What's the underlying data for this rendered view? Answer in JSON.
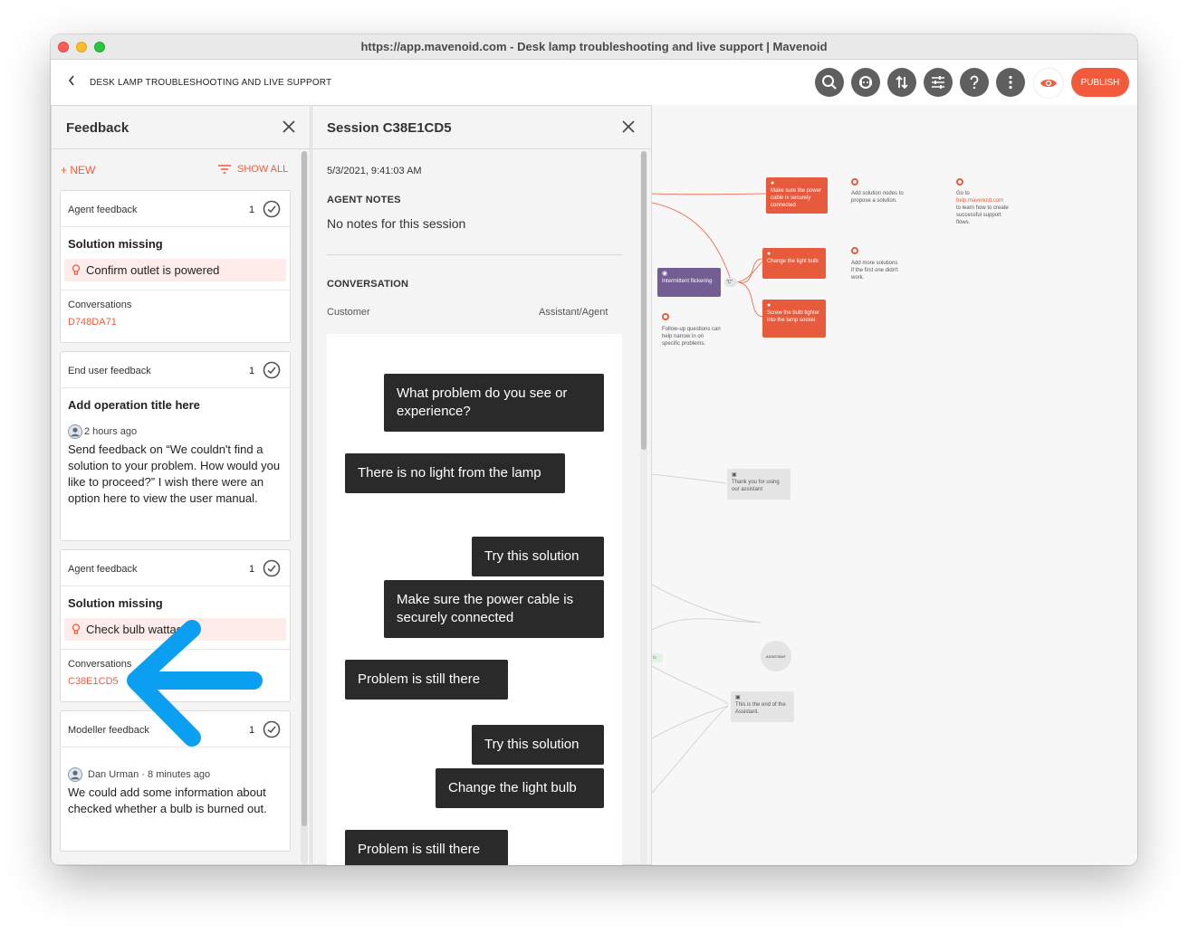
{
  "window": {
    "title": "https://app.mavenoid.com - Desk lamp troubleshooting and live support | Mavenoid"
  },
  "header": {
    "back_icon": "chevron-left-icon",
    "breadcrumb": "DESK LAMP TROUBLESHOOTING AND LIVE SUPPORT",
    "tools": [
      "search-icon",
      "agent-icon",
      "sort-icon",
      "sliders-icon",
      "help-icon",
      "more-icon"
    ],
    "preview_icon": "eye-icon",
    "publish_label": "PUBLISH",
    "accent": "#f15a3a"
  },
  "feedback": {
    "title": "Feedback",
    "new_label": "+ NEW",
    "show_all_label": "SHOW ALL",
    "cards": [
      {
        "type": "Agent feedback",
        "count": "1",
        "title": "Solution missing",
        "solution": "Confirm outlet is powered",
        "conversations_label": "Conversations",
        "conversation_id": "D748DA71"
      },
      {
        "type": "End user feedback",
        "count": "1",
        "title": "Add operation title here",
        "meta": "2 hours ago",
        "body": "Send feedback on “We couldn't find a solution to your problem. How would you like to proceed?” I wish there were an option here to view the user manual."
      },
      {
        "type": "Agent feedback",
        "count": "1",
        "title": "Solution missing",
        "solution": "Check bulb wattage",
        "conversations_label": "Conversations",
        "conversation_id": "C38E1CD5"
      },
      {
        "type": "Modeller feedback",
        "count": "1",
        "meta": "Dan Urman · 8 minutes ago",
        "body": "We could add some information about checked whether a bulb is burned out."
      }
    ]
  },
  "session": {
    "title": "Session C38E1CD5",
    "date": "5/3/2021, 9:41:03 AM",
    "notes_label": "AGENT NOTES",
    "notes": "No notes for this session",
    "conversation_label": "CONVERSATION",
    "customer_label": "Customer",
    "agent_label": "Assistant/Agent",
    "messages": [
      {
        "side": "right",
        "text": "What problem do you see or experience?"
      },
      {
        "side": "left",
        "text": "There is no light from the lamp"
      },
      {
        "side": "right",
        "text": "Try this solution"
      },
      {
        "side": "right",
        "text": "Make sure the power cable is securely connected"
      },
      {
        "side": "left",
        "text": "Problem is still there"
      },
      {
        "side": "right",
        "text": "Try this solution"
      },
      {
        "side": "right",
        "text": "Change the light bulb"
      },
      {
        "side": "left",
        "text": "Problem is still there"
      }
    ]
  },
  "flow": {
    "solution_1": "Make sure the power cable is securely connected",
    "solution_2": "Change the light bulb",
    "solution_3": "Screw the bulb tighter into the lamp socket",
    "question": "Intermittent flickering",
    "badge": "\"C\"",
    "note_1": "Add solution nodes to propose a solution.",
    "note_2_prefix": "Go to",
    "note_2_link": "help.mavenoid.com",
    "note_2_suffix": "to learn how to create successful support flows.",
    "note_3": "Add more solutions if the first one didn't work.",
    "note_4": "Follow-up questions can help narrow in on specific problems.",
    "thank_you": "Thank you for using our assistant",
    "assistant_node": "ASSISTANT",
    "end_node": "This is the end of the Assistant.",
    "partial_label": "ts"
  }
}
